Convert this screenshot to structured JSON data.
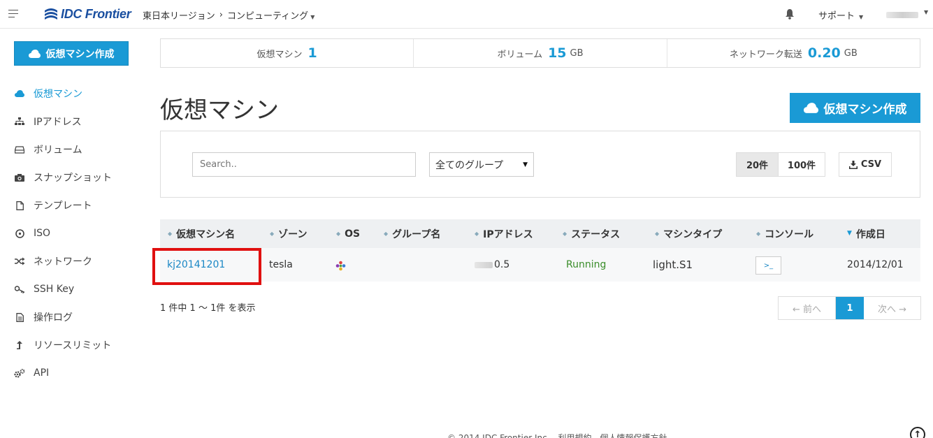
{
  "header": {
    "logo_text": "IDC Frontier",
    "breadcrumb": [
      "東日本リージョン",
      "コンピューティング"
    ],
    "support_label": "サポート"
  },
  "sidebar": {
    "create_label": "仮想マシン作成",
    "items": [
      {
        "label": "仮想マシン",
        "icon": "cloud-icon"
      },
      {
        "label": "IPアドレス",
        "icon": "sitemap-icon"
      },
      {
        "label": "ボリューム",
        "icon": "hdd-icon"
      },
      {
        "label": "スナップショット",
        "icon": "camera-icon"
      },
      {
        "label": "テンプレート",
        "icon": "file-icon"
      },
      {
        "label": "ISO",
        "icon": "disc-icon"
      },
      {
        "label": "ネットワーク",
        "icon": "shuffle-icon"
      },
      {
        "label": "SSH Key",
        "icon": "key-icon"
      },
      {
        "label": "操作ログ",
        "icon": "document-icon"
      },
      {
        "label": "リソースリミット",
        "icon": "level-up-icon"
      },
      {
        "label": "API",
        "icon": "gears-icon"
      }
    ],
    "active_index": 0
  },
  "summary": {
    "vm_label": "仮想マシン",
    "vm_count": "1",
    "volume_label": "ボリューム",
    "volume_value": "15",
    "volume_unit": "GB",
    "network_label": "ネットワーク転送",
    "network_value": "0.20",
    "network_unit": "GB"
  },
  "page": {
    "title": "仮想マシン",
    "create_label": "仮想マシン作成"
  },
  "filter": {
    "search_placeholder": "Search..",
    "group_selected": "全てのグループ",
    "per_page_options": [
      "20件",
      "100件"
    ],
    "per_page_selected": "20件",
    "csv_label": "CSV"
  },
  "table": {
    "columns": [
      "仮想マシン名",
      "ゾーン",
      "OS",
      "グループ名",
      "IPアドレス",
      "ステータス",
      "マシンタイプ",
      "コンソール",
      "作成日"
    ],
    "rows": [
      {
        "name": "kj20141201",
        "zone": "tesla",
        "os_icon": "os-logo-icon",
        "group": "",
        "ip_suffix": "0.5",
        "status": "Running",
        "machine_type": "light.S1",
        "console": ">_",
        "created": "2014/12/01"
      }
    ]
  },
  "pagination": {
    "summary": "1 件中 1 ～ 1件 を表示",
    "prev_label": "← 前へ",
    "current": "1",
    "next_label": "次へ →"
  },
  "footer": {
    "text": "© 2014 IDC Frontier Inc.　利用規約　個人情報保護方針"
  },
  "colors": {
    "accent": "#1a9ad5",
    "running": "#3a8d2a",
    "highlight": "#e01010"
  }
}
